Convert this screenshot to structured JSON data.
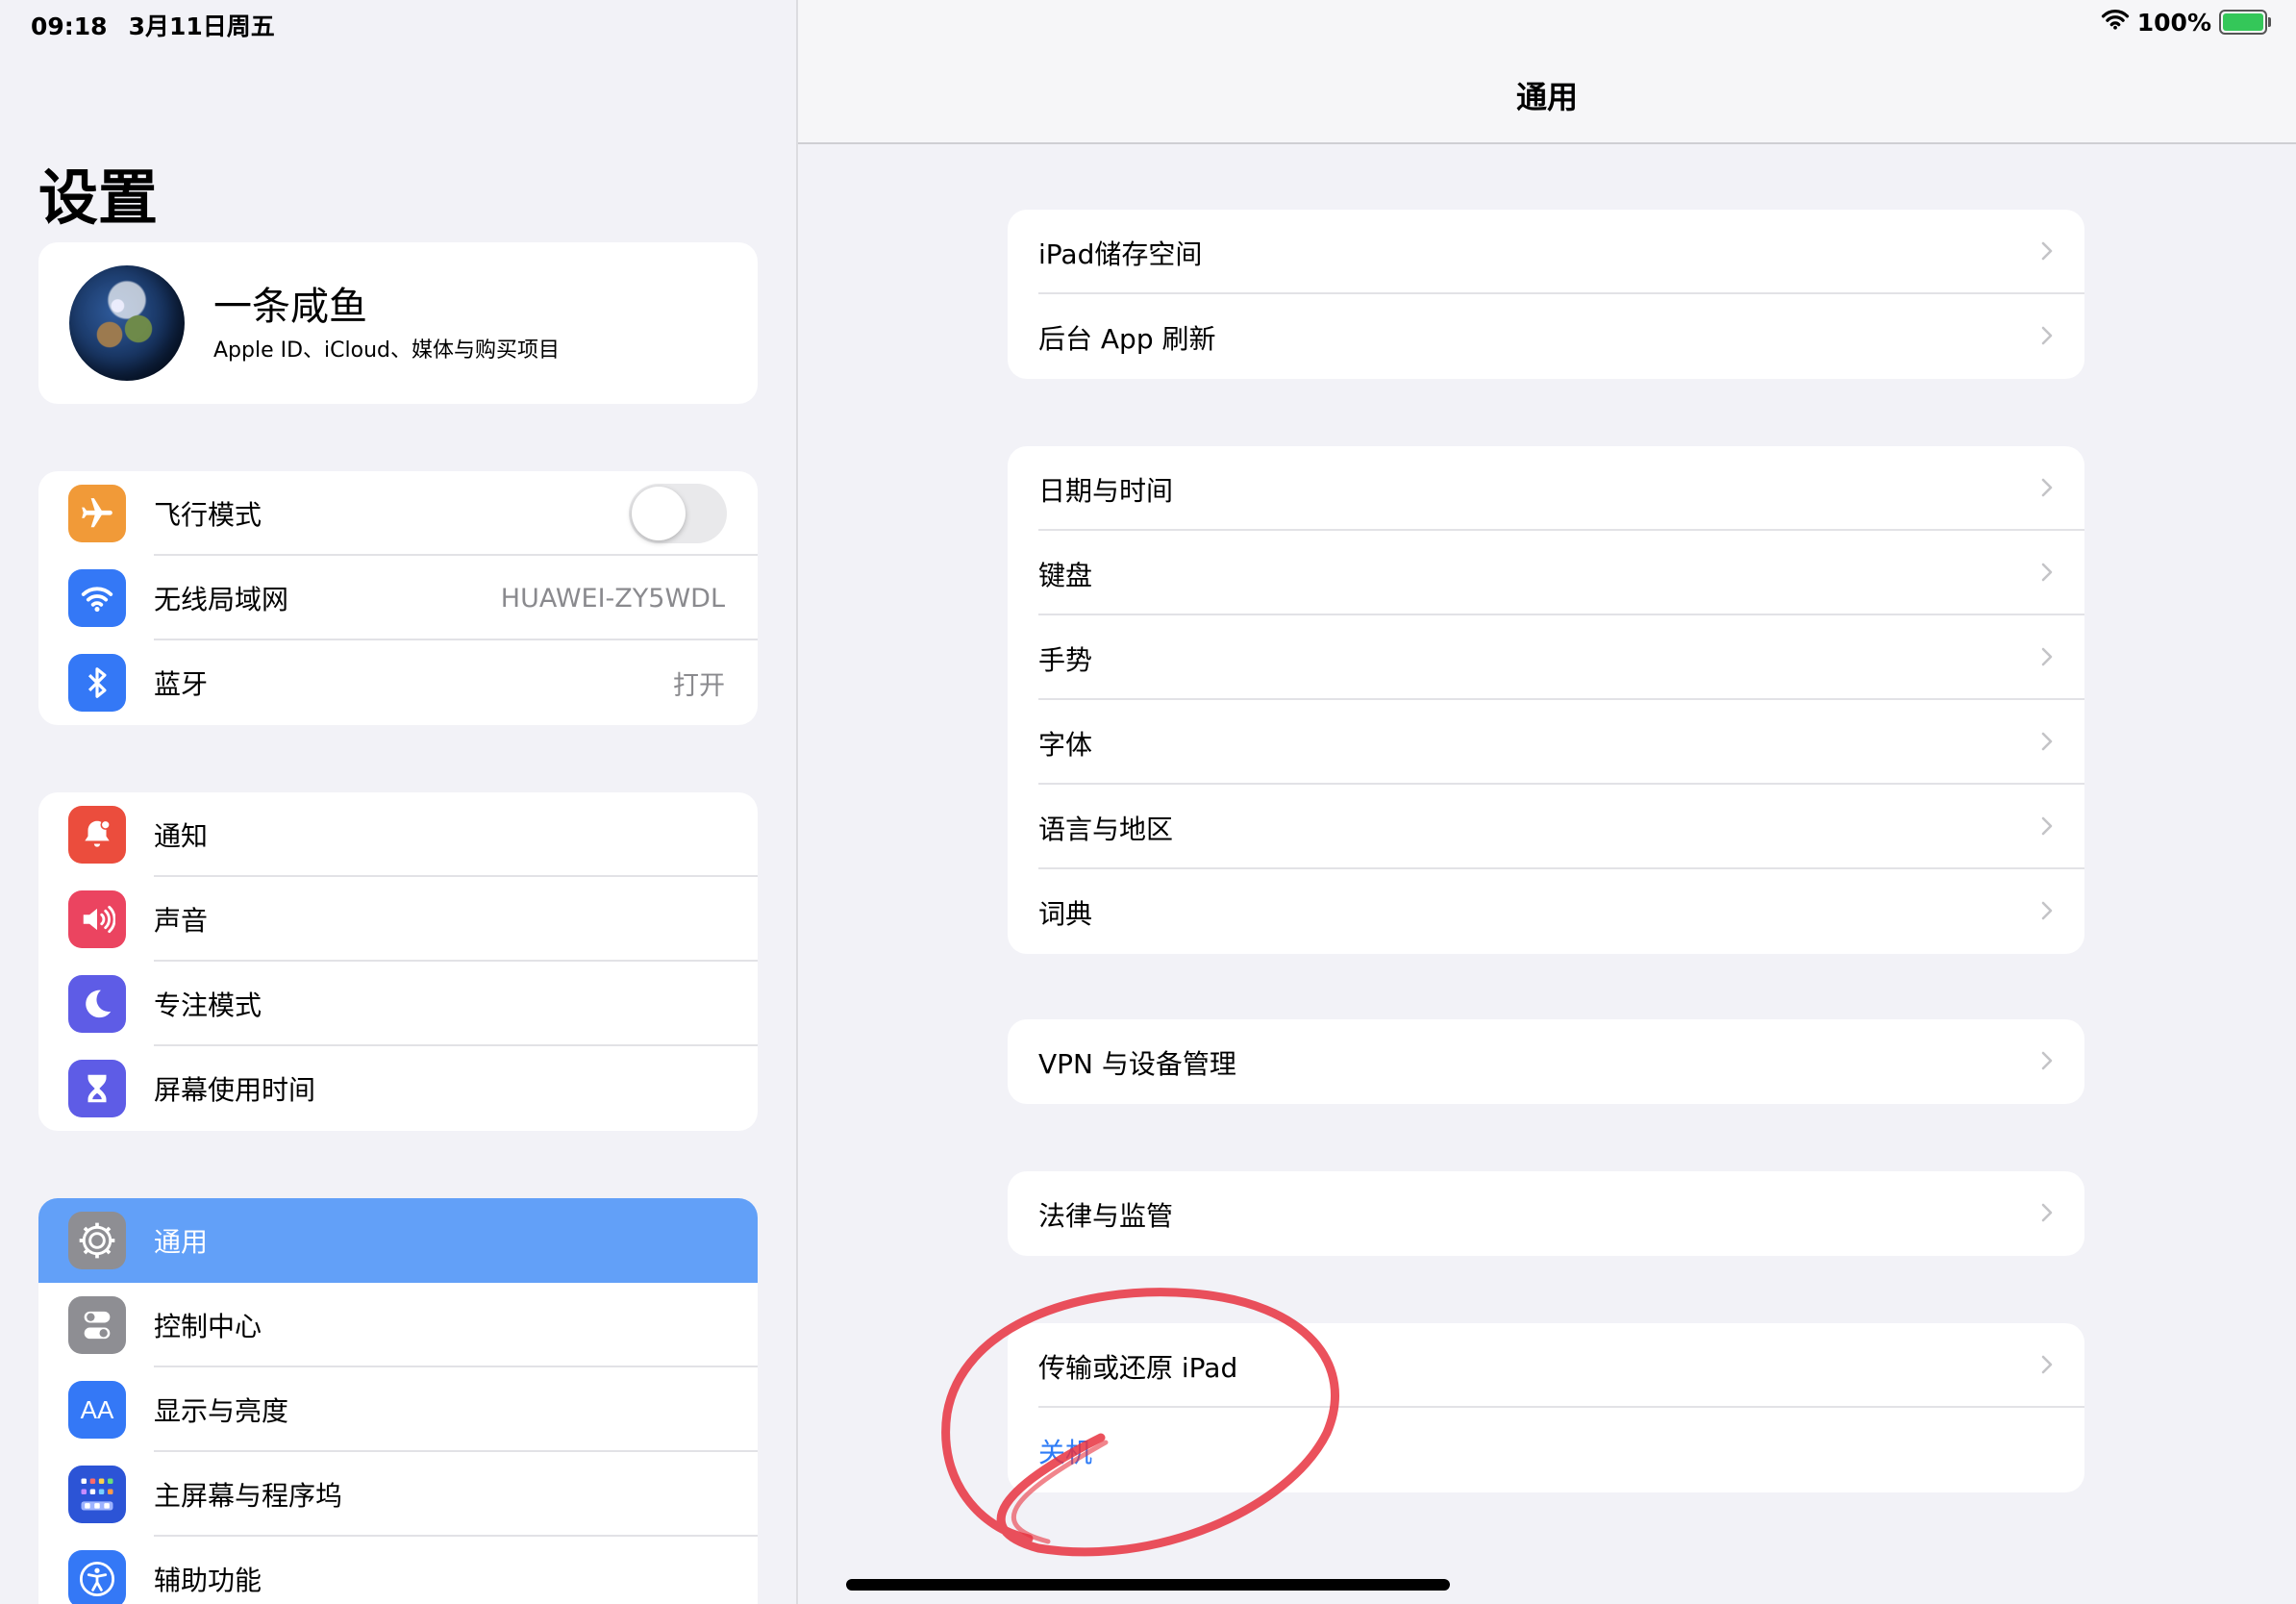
{
  "status": {
    "time": "09:18",
    "date": "3月11日周五",
    "battery": "100%",
    "icons": [
      "wifi-icon",
      "battery-charging-icon"
    ]
  },
  "sidebar": {
    "title": "设置",
    "profile": {
      "name": "一条咸鱼",
      "subtitle": "Apple ID、iCloud、媒体与购买项目"
    },
    "group1": [
      {
        "label": "飞行模式",
        "icon": "airplane-icon",
        "color": "#f19a38",
        "toggle": false
      },
      {
        "label": "无线局域网",
        "icon": "wifi-icon",
        "color": "#3478f6",
        "value": "HUAWEI-ZY5WDL"
      },
      {
        "label": "蓝牙",
        "icon": "bluetooth-icon",
        "color": "#3478f6",
        "value": "打开"
      }
    ],
    "group2": [
      {
        "label": "通知",
        "icon": "bell-icon",
        "color": "#eb4d3d"
      },
      {
        "label": "声音",
        "icon": "speaker-icon",
        "color": "#eb4460"
      },
      {
        "label": "专注模式",
        "icon": "moon-icon",
        "color": "#5e5ce6"
      },
      {
        "label": "屏幕使用时间",
        "icon": "hourglass-icon",
        "color": "#5e5ce6"
      }
    ],
    "group3": [
      {
        "label": "通用",
        "icon": "gear-icon",
        "color": "#8e8e93",
        "selected": true
      },
      {
        "label": "控制中心",
        "icon": "toggles-icon",
        "color": "#8e8e93"
      },
      {
        "label": "显示与亮度",
        "icon": "text-size-icon",
        "color": "#3478f6",
        "glyph": "AA"
      },
      {
        "label": "主屏幕与程序坞",
        "icon": "home-grid-icon",
        "color": "#2c54d6"
      },
      {
        "label": "辅助功能",
        "icon": "accessibility-icon",
        "color": "#3478f6"
      }
    ]
  },
  "detail": {
    "title": "通用",
    "groups": [
      [
        "iPad储存空间",
        "后台 App 刷新"
      ],
      [
        "日期与时间",
        "键盘",
        "手势",
        "字体",
        "语言与地区",
        "词典"
      ],
      [
        "VPN 与设备管理"
      ],
      [
        "法律与监管"
      ],
      [
        "传输或还原 iPad",
        "关机"
      ]
    ]
  },
  "colors": {
    "accent": "#2f7cf6",
    "selected_row": "#62a0f8",
    "annotation": "#e8333f"
  }
}
